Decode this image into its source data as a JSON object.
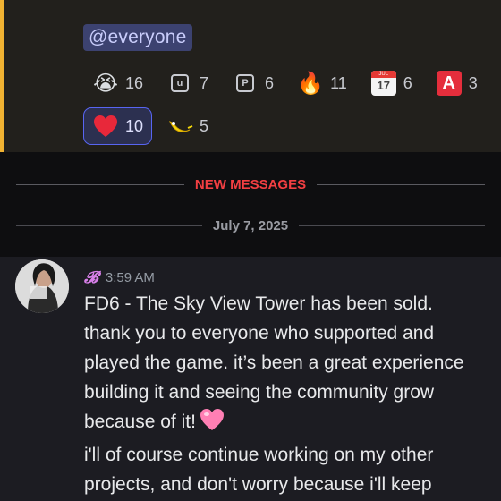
{
  "mention": {
    "text": "@everyone"
  },
  "reactions": [
    {
      "emoji": "loudly-crying-face",
      "glyph": "😭",
      "count": "16",
      "active": false
    },
    {
      "emoji": "u-square-icon",
      "glyph": "u",
      "count": "7",
      "active": false
    },
    {
      "emoji": "p-square-icon",
      "glyph": "P",
      "count": "6",
      "active": false
    },
    {
      "emoji": "fire",
      "glyph": "🔥",
      "count": "11",
      "active": false
    },
    {
      "emoji": "calendar",
      "glyph": "17",
      "cal_top": "JUL",
      "count": "6",
      "active": false
    },
    {
      "emoji": "a-button",
      "glyph": "A",
      "count": "3",
      "active": false
    },
    {
      "emoji": "red-heart",
      "glyph": "❤",
      "count": "10",
      "active": true
    },
    {
      "emoji": "banana-custom",
      "glyph": "🍌",
      "count": "5",
      "active": false
    }
  ],
  "dividers": {
    "new_messages": "NEW MESSAGES",
    "date": "July 7, 2025"
  },
  "message": {
    "username": "𝓑",
    "timestamp": "3:59 AM",
    "lines": [
      "FD6 - The Sky View Tower has been sold.",
      "thank you to everyone who supported and played the game. it’s been a great experience building it and seeing the community grow because of it!",
      "i'll of course continue working on my other projects, and don't worry because i'll keep"
    ]
  },
  "colors": {
    "mention_bar": "#f0b232",
    "mention_chip_bg": "#3c4270",
    "new_messages": "#f23f42",
    "username": "#d77fe8",
    "active_reaction_border": "#5865f2"
  }
}
